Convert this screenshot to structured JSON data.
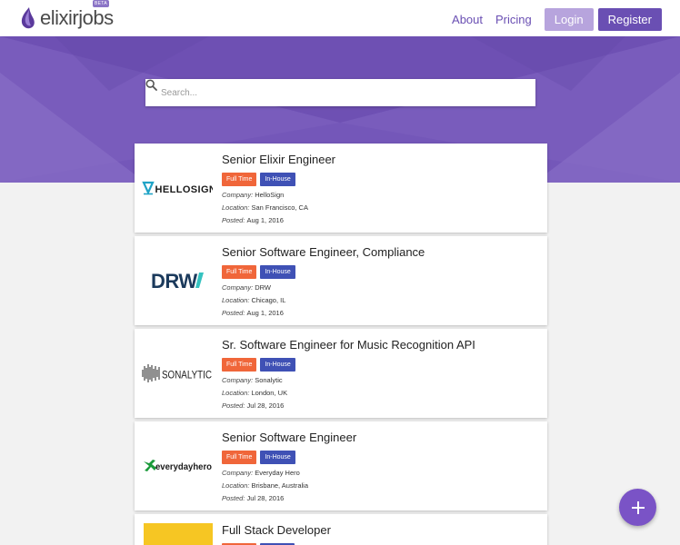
{
  "brand": {
    "name": "elixirjobs",
    "badge": "BETA"
  },
  "nav": {
    "about": "About",
    "pricing": "Pricing",
    "login": "Login",
    "register": "Register"
  },
  "search": {
    "placeholder": "Search...",
    "value": ""
  },
  "jobs": [
    {
      "title": "Senior Elixir Engineer",
      "tags": [
        "Full Time",
        "In-House"
      ],
      "company_label": "Company:",
      "company": "HelloSign",
      "location_label": "Location:",
      "location": "San Francisco, CA",
      "posted_label": "Posted:",
      "posted": "Aug 1, 2016",
      "logo_text": "HELLOSIGN"
    },
    {
      "title": "Senior Software Engineer, Compliance",
      "tags": [
        "Full Time",
        "In-House"
      ],
      "company_label": "Company:",
      "company": "DRW",
      "location_label": "Location:",
      "location": "Chicago, IL",
      "posted_label": "Posted:",
      "posted": "Aug 1, 2016",
      "logo_text": "DRW"
    },
    {
      "title": "Sr. Software Engineer for Music Recognition API",
      "tags": [
        "Full Time",
        "In-House"
      ],
      "company_label": "Company:",
      "company": "Sonalytic",
      "location_label": "Location:",
      "location": "London, UK",
      "posted_label": "Posted:",
      "posted": "Jul 28, 2016",
      "logo_text": "SONALYTIC"
    },
    {
      "title": "Senior Software Engineer",
      "tags": [
        "Full Time",
        "In-House"
      ],
      "company_label": "Company:",
      "company": "Everyday Hero",
      "location_label": "Location:",
      "location": "Brisbane, Australia",
      "posted_label": "Posted:",
      "posted": "Jul 28, 2016",
      "logo_text": "everydayhero"
    },
    {
      "title": "Full Stack Developer"
    }
  ],
  "colors": {
    "brand_purple": "#7457b9",
    "full_time": "#f0663a",
    "in_house": "#3f51b5",
    "fab": "#7a53c6"
  },
  "icons": {
    "search": "search-icon",
    "fab": "plus-icon",
    "logo": "elixir-drop-logo"
  }
}
